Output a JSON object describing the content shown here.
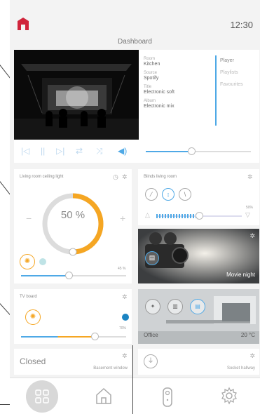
{
  "status": {
    "time": "12:30",
    "title": "Dashboard"
  },
  "media": {
    "info": [
      {
        "label": "Room",
        "value": "Kitchen"
      },
      {
        "label": "Source",
        "value": "Spotify"
      },
      {
        "label": "Title",
        "value": "Electronic soft"
      },
      {
        "label": "Album",
        "value": "Electronic mix"
      }
    ],
    "menu": [
      "Player",
      "Playlists",
      "Favourites"
    ],
    "volume": 0.43
  },
  "light": {
    "title": "Living room ceiling light",
    "percent": "50 %",
    "level": 0.5,
    "dim_value": "45 %",
    "dim_level": 0.45
  },
  "blinds": {
    "title": "Blinds living room",
    "value": "50%",
    "level": 0.5
  },
  "movie": {
    "name": "Movie night"
  },
  "tv": {
    "title": "TV board",
    "value": "70%",
    "level": 0.7
  },
  "office": {
    "name": "Office",
    "temp": "20 °C"
  },
  "window": {
    "state": "Closed",
    "name": "Basement window"
  },
  "socket": {
    "name": "Socket hallway"
  },
  "colors": {
    "accent_blue": "#4fa9e6",
    "accent_orange": "#f5a623",
    "logo_red": "#d0243b"
  },
  "icons": [
    "home-logo-icon",
    "previous-icon",
    "pause-icon",
    "next-icon",
    "repeat-icon",
    "shuffle-icon",
    "speaker-icon",
    "clock-icon",
    "gear-icon",
    "bulb-icon",
    "blind-icon",
    "film-icon",
    "plug-icon",
    "grid-icon",
    "house-icon",
    "remote-icon",
    "settings-icon"
  ]
}
